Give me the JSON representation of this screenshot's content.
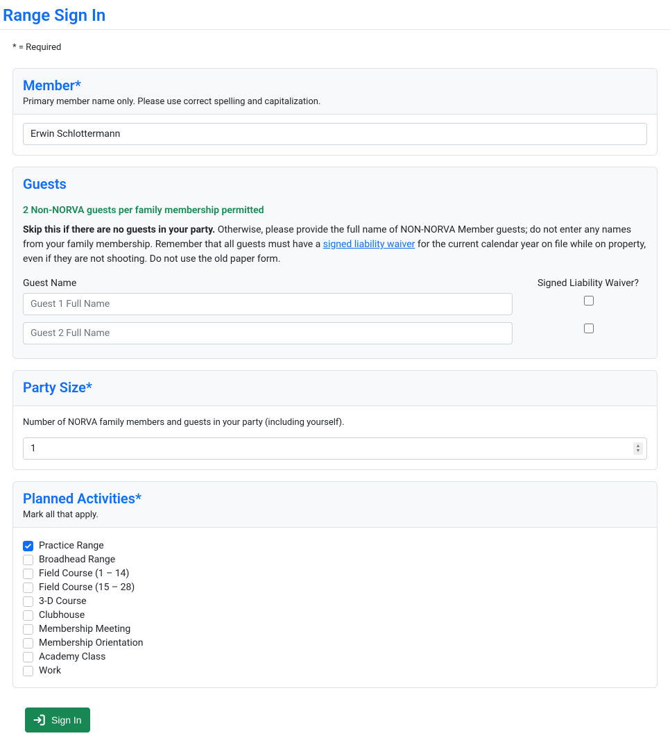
{
  "page": {
    "title": "Range Sign In",
    "required_note": "* = Required"
  },
  "member": {
    "title": "Member*",
    "sub": "Primary member name only. Please use correct spelling and capitalization.",
    "value": "Erwin Schlottermann"
  },
  "guests": {
    "title": "Guests",
    "limit_note": "2 Non-NORVA guests per family membership permitted",
    "skip_bold": "Skip this if there are no guests in your party.",
    "skip_rest_1": " Otherwise, please provide the full name of NON-NORVA Member guests; do not enter any names from your family membership. Remember that all guests must have a ",
    "waiver_link": "signed liability waiver",
    "skip_rest_2": " for the current calendar year on file while on property, even if they are not shooting. Do not use the old paper form.",
    "guest_name_label": "Guest Name",
    "waiver_label": "Signed Liability Waiver?",
    "rows": [
      {
        "placeholder": "Guest 1 Full Name"
      },
      {
        "placeholder": "Guest 2 Full Name"
      }
    ]
  },
  "party": {
    "title": "Party Size*",
    "sub": "Number of NORVA family members and guests in your party (including yourself).",
    "value": "1"
  },
  "activities": {
    "title": "Planned Activities*",
    "sub": "Mark all that apply.",
    "items": [
      {
        "label": "Practice Range",
        "checked": true
      },
      {
        "label": "Broadhead Range",
        "checked": false
      },
      {
        "label": "Field Course (1 – 14)",
        "checked": false
      },
      {
        "label": "Field Course (15 – 28)",
        "checked": false
      },
      {
        "label": "3-D Course",
        "checked": false
      },
      {
        "label": "Clubhouse",
        "checked": false
      },
      {
        "label": "Membership Meeting",
        "checked": false
      },
      {
        "label": "Membership Orientation",
        "checked": false
      },
      {
        "label": "Academy Class",
        "checked": false
      },
      {
        "label": "Work",
        "checked": false
      }
    ]
  },
  "signin": {
    "label": "Sign In"
  }
}
